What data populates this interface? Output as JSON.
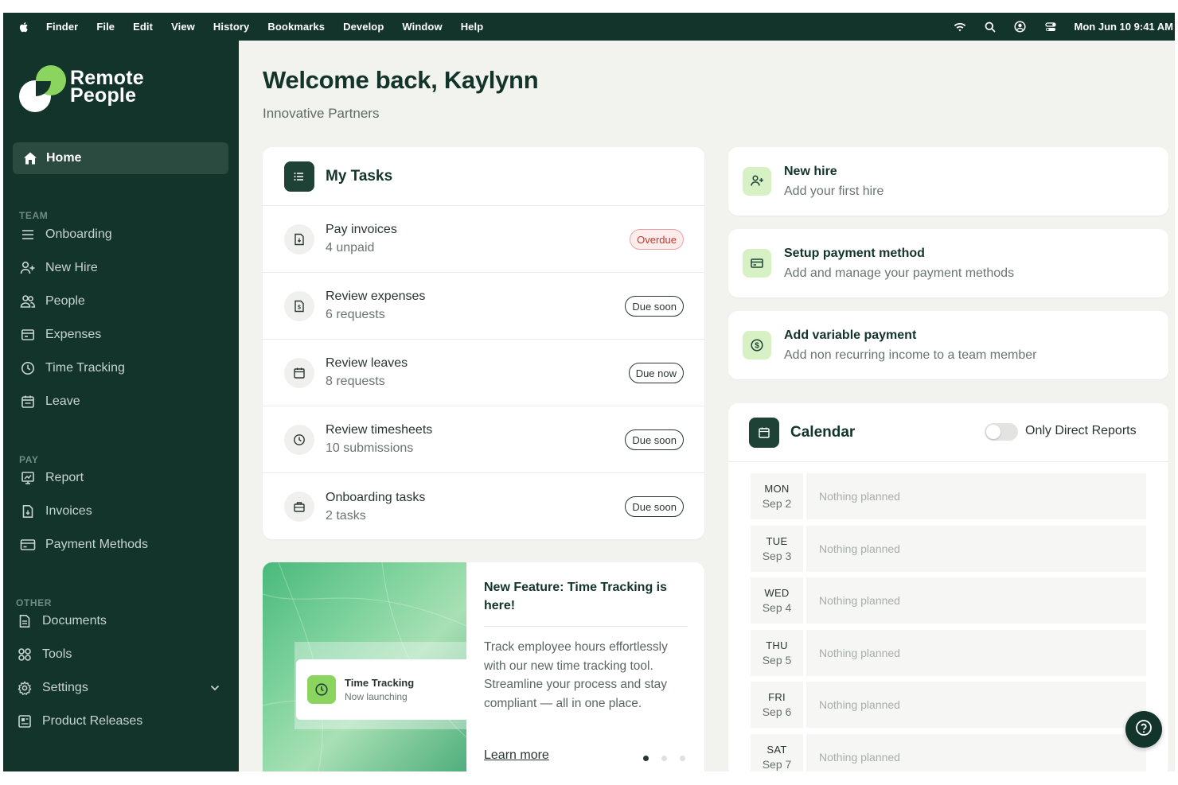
{
  "menubar": {
    "items": [
      "Finder",
      "File",
      "Edit",
      "View",
      "History",
      "Bookmarks",
      "Develop",
      "Window",
      "Help"
    ],
    "clock": "Mon Jun 10  9:41 AM"
  },
  "sidebar": {
    "logo_line1": "Remote",
    "logo_line2": "People",
    "home": "Home",
    "team_label": "TEAM",
    "team": [
      "Onboarding",
      "New Hire",
      "People",
      "Expenses",
      "Time Tracking",
      "Leave"
    ],
    "pay_label": "PAY",
    "pay": [
      "Report",
      "Invoices",
      "Payment Methods"
    ],
    "other_label": "OTHER",
    "other": [
      "Documents",
      "Tools",
      "Settings",
      "Product Releases"
    ]
  },
  "main": {
    "welcome": "Welcome back, Kaylynn",
    "company": "Innovative Partners"
  },
  "tasks": {
    "title": "My Tasks",
    "items": [
      {
        "title": "Pay invoices",
        "sub": "4 unpaid",
        "badge": "Overdue",
        "icon": "invoice-icon"
      },
      {
        "title": "Review expenses",
        "sub": "6 requests",
        "badge": "Due soon",
        "icon": "receipt-icon"
      },
      {
        "title": "Review leaves",
        "sub": "8 requests",
        "badge": "Due now",
        "icon": "calendar-icon"
      },
      {
        "title": "Review timesheets",
        "sub": "10 submissions",
        "badge": "Due soon",
        "icon": "clock-icon"
      },
      {
        "title": "Onboarding tasks",
        "sub": "2 tasks",
        "badge": "Due soon",
        "icon": "briefcase-icon"
      }
    ]
  },
  "feature": {
    "title": "New Feature: Time Tracking is here!",
    "desc": "Track employee hours effortlessly with our new time tracking tool. Streamline your process and stay compliant — all in one place.",
    "link": "Learn more",
    "card_title": "Time Tracking",
    "card_sub": "Now launching"
  },
  "actions": [
    {
      "title": "New hire",
      "sub": "Add your first hire",
      "icon": "add-user-icon"
    },
    {
      "title": "Setup payment method",
      "sub": "Add and manage your payment methods",
      "icon": "credit-card-icon"
    },
    {
      "title": "Add variable payment",
      "sub": "Add non recurring income to a team member",
      "icon": "dollar-icon"
    }
  ],
  "calendar": {
    "title": "Calendar",
    "toggle_label": "Only Direct Reports",
    "days": [
      {
        "dow": "MON",
        "date": "Sep 2",
        "text": "Nothing planned"
      },
      {
        "dow": "TUE",
        "date": "Sep 3",
        "text": "Nothing planned"
      },
      {
        "dow": "WED",
        "date": "Sep 4",
        "text": "Nothing planned"
      },
      {
        "dow": "THU",
        "date": "Sep 5",
        "text": "Nothing planned"
      },
      {
        "dow": "FRI",
        "date": "Sep 6",
        "text": "Nothing planned"
      },
      {
        "dow": "SAT",
        "date": "Sep 7",
        "text": "Nothing planned"
      }
    ]
  },
  "colors": {
    "sidebar": "#12342a",
    "accent_green": "#8ad45f",
    "overdue": "#c0392b"
  }
}
